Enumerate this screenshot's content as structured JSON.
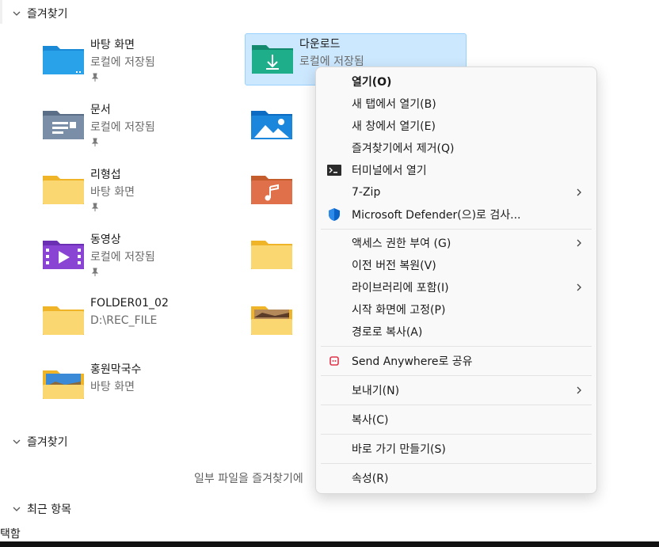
{
  "sections": {
    "favorites_top": "즐겨찾기",
    "favorites_bottom": "즐겨찾기",
    "recent": "최근 항목"
  },
  "folders": [
    {
      "name": "바탕 화면",
      "sub": "로컬에 저장됨",
      "pinned": true,
      "icon": "desktop-folder-icon"
    },
    {
      "name": "다운로드",
      "sub": "로컬에 저장됨",
      "pinned": false,
      "icon": "downloads-folder-icon"
    },
    {
      "name": "문서",
      "sub": "로컬에 저장됨",
      "pinned": true,
      "icon": "documents-folder-icon"
    },
    {
      "name": "리형섭",
      "sub": "바탕 화면",
      "pinned": true,
      "icon": "folder-icon"
    },
    {
      "name": "동영상",
      "sub": "로컬에 저장됨",
      "pinned": true,
      "icon": "videos-folder-icon"
    },
    {
      "name": "FOLDER01_02",
      "sub": "D:\\REC_FILE",
      "pinned": false,
      "icon": "folder-icon"
    },
    {
      "name": "홍원막국수",
      "sub": "바탕 화면",
      "pinned": false,
      "icon": "photo-folder-icon"
    }
  ],
  "empty_note": "일부 파일을 즐겨찾기에",
  "status_left": "택함",
  "context_menu": {
    "items": [
      {
        "label": "열기(O)",
        "bold": true
      },
      {
        "label": "새 탭에서 열기(B)"
      },
      {
        "label": "새 창에서 열기(E)"
      },
      {
        "label": "즐겨찾기에서 제거(Q)"
      },
      {
        "label": "터미널에서 열기",
        "icon": "terminal-icon"
      },
      {
        "label": "7-Zip",
        "submenu": true
      },
      {
        "label": "Microsoft Defender(으)로 검사...",
        "icon": "defender-shield-icon"
      },
      {
        "label": "액세스 권한 부여 (G)",
        "submenu": true
      },
      {
        "label": "이전 버전 복원(V)"
      },
      {
        "label": "라이브러리에 포함(I)",
        "submenu": true
      },
      {
        "label": "시작 화면에 고정(P)"
      },
      {
        "label": "경로로 복사(A)"
      },
      {
        "label": "Send Anywhere로 공유",
        "icon": "send-anywhere-icon"
      },
      {
        "label": "보내기(N)",
        "submenu": true
      },
      {
        "label": "복사(C)"
      },
      {
        "label": "바로 가기 만들기(S)"
      },
      {
        "label": "속성(R)"
      }
    ]
  },
  "colors": {
    "selection_bg": "#cce8ff",
    "folder_yellow": "#f7c94b",
    "accent_blue": "#0a64c8",
    "send_anywhere_red": "#e0354b"
  }
}
